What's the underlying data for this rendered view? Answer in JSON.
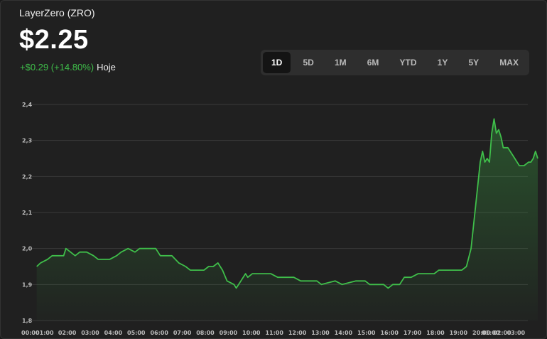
{
  "header": {
    "title": "LayerZero (ZRO)",
    "price": "$2.25",
    "change": "+$0.29 (+14.80%)",
    "period": "Hoje"
  },
  "ranges": [
    "1D",
    "5D",
    "1M",
    "6M",
    "YTD",
    "1Y",
    "5Y",
    "MAX"
  ],
  "active_range": "1D",
  "colors": {
    "line": "#3fbe4a",
    "accent": "#3fbe4a",
    "grid": "#3a3a3a"
  },
  "chart_data": {
    "type": "area",
    "title": "",
    "xlabel": "",
    "ylabel": "",
    "ylim": [
      1.8,
      2.4
    ],
    "y_ticks": [
      "2,4",
      "2,3",
      "2,2",
      "2,1",
      "2,0",
      "1,9",
      "1,8"
    ],
    "y_tick_values": [
      2.4,
      2.3,
      2.2,
      2.1,
      2.0,
      1.9,
      1.8
    ],
    "x_ticks": [
      "00:00",
      "01:00",
      "02:00",
      "03:00",
      "04:00",
      "05:00",
      "06:00",
      "07:00",
      "08:00",
      "09:00",
      "10:00",
      "11:00",
      "12:00",
      "13:00",
      "14:00",
      "15:00",
      "16:00",
      "17:00",
      "18:00",
      "19:00",
      "20:00",
      "01:00",
      "02:00",
      "03:00"
    ],
    "x_tick_hours": [
      0,
      0.62,
      1.6,
      2.6,
      3.6,
      4.6,
      5.6,
      6.6,
      7.6,
      8.6,
      9.6,
      10.6,
      11.6,
      12.6,
      13.6,
      14.6,
      15.6,
      16.6,
      17.6,
      18.6,
      19.6,
      20.0,
      20.5,
      21.1
    ],
    "grid": true,
    "series": [
      {
        "values": [
          [
            0.33,
            1.95
          ],
          [
            0.5,
            1.96
          ],
          [
            0.8,
            1.97
          ],
          [
            1.0,
            1.98
          ],
          [
            1.5,
            1.98
          ],
          [
            1.6,
            2.0
          ],
          [
            1.8,
            1.99
          ],
          [
            2.0,
            1.98
          ],
          [
            2.2,
            1.99
          ],
          [
            2.5,
            1.99
          ],
          [
            2.8,
            1.98
          ],
          [
            3.0,
            1.97
          ],
          [
            3.5,
            1.97
          ],
          [
            3.8,
            1.98
          ],
          [
            4.0,
            1.99
          ],
          [
            4.3,
            2.0
          ],
          [
            4.6,
            1.99
          ],
          [
            4.8,
            2.0
          ],
          [
            5.0,
            2.0
          ],
          [
            5.5,
            2.0
          ],
          [
            5.7,
            1.98
          ],
          [
            6.2,
            1.98
          ],
          [
            6.5,
            1.96
          ],
          [
            6.8,
            1.95
          ],
          [
            7.0,
            1.94
          ],
          [
            7.6,
            1.94
          ],
          [
            7.8,
            1.95
          ],
          [
            8.0,
            1.95
          ],
          [
            8.2,
            1.96
          ],
          [
            8.4,
            1.94
          ],
          [
            8.6,
            1.91
          ],
          [
            8.9,
            1.9
          ],
          [
            9.0,
            1.89
          ],
          [
            9.2,
            1.91
          ],
          [
            9.4,
            1.93
          ],
          [
            9.5,
            1.92
          ],
          [
            9.7,
            1.93
          ],
          [
            10.0,
            1.93
          ],
          [
            10.5,
            1.93
          ],
          [
            10.8,
            1.92
          ],
          [
            11.5,
            1.92
          ],
          [
            11.8,
            1.91
          ],
          [
            12.5,
            1.91
          ],
          [
            12.7,
            1.9
          ],
          [
            13.3,
            1.91
          ],
          [
            13.6,
            1.9
          ],
          [
            14.2,
            1.91
          ],
          [
            14.6,
            1.91
          ],
          [
            14.8,
            1.9
          ],
          [
            15.4,
            1.9
          ],
          [
            15.6,
            1.89
          ],
          [
            15.8,
            1.9
          ],
          [
            16.1,
            1.9
          ],
          [
            16.3,
            1.92
          ],
          [
            16.6,
            1.92
          ],
          [
            16.9,
            1.93
          ],
          [
            17.2,
            1.93
          ],
          [
            17.6,
            1.93
          ],
          [
            17.8,
            1.94
          ],
          [
            18.0,
            1.94
          ],
          [
            18.4,
            1.94
          ],
          [
            18.8,
            1.94
          ],
          [
            19.0,
            1.95
          ],
          [
            19.2,
            2.0
          ],
          [
            19.4,
            2.12
          ],
          [
            19.6,
            2.24
          ],
          [
            19.7,
            2.27
          ],
          [
            19.8,
            2.24
          ],
          [
            19.9,
            2.25
          ],
          [
            20.0,
            2.24
          ],
          [
            20.1,
            2.32
          ],
          [
            20.2,
            2.36
          ],
          [
            20.3,
            2.32
          ],
          [
            20.4,
            2.33
          ],
          [
            20.5,
            2.31
          ],
          [
            20.6,
            2.28
          ],
          [
            20.8,
            2.28
          ],
          [
            21.0,
            2.26
          ],
          [
            21.2,
            2.24
          ],
          [
            21.3,
            2.23
          ],
          [
            21.5,
            2.23
          ],
          [
            21.7,
            2.24
          ],
          [
            21.8,
            2.24
          ],
          [
            21.9,
            2.25
          ],
          [
            22.0,
            2.27
          ],
          [
            22.1,
            2.25
          ]
        ]
      }
    ]
  }
}
